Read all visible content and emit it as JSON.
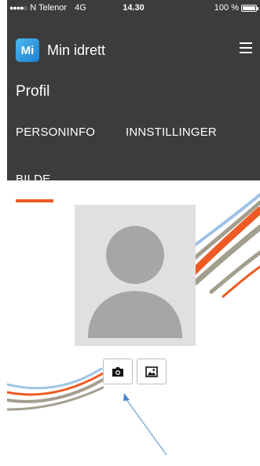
{
  "status_bar": {
    "signal_dots": "●●●●○",
    "carrier": "N Telenor",
    "network": "4G",
    "time": "14.30",
    "battery": "100 %"
  },
  "app": {
    "logo_text": "Mi",
    "title": "Min idrett"
  },
  "page": {
    "title": "Profil"
  },
  "tabs": [
    {
      "label": "PERSONINFO"
    },
    {
      "label": "INNSTILLINGER"
    },
    {
      "label": "BILDE",
      "active": true
    }
  ],
  "icons": {
    "menu": "hamburger-icon",
    "camera": "camera-icon",
    "image": "image-icon",
    "avatar": "person-silhouette-icon"
  },
  "colors": {
    "header_bg": "#3c3c3c",
    "accent": "#ee5a24",
    "swoosh_blue": "#9ec3e6",
    "swoosh_grey": "#a39e8e",
    "arrow": "#4a88c8"
  }
}
